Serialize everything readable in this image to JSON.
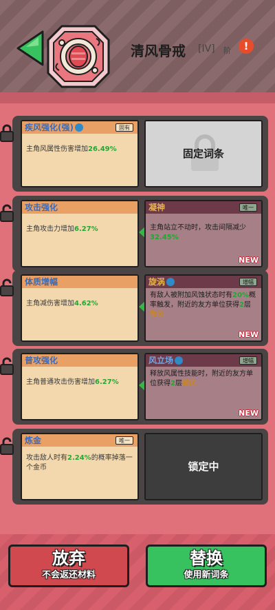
{
  "header": {
    "item_name": "清风骨戒",
    "tier": "[IV]",
    "tier_suffix": "阶",
    "warn": "!"
  },
  "rows": [
    {
      "left": {
        "title": "疾风强化(强)",
        "badge": "固有",
        "desc_pre": "主角风属性伤害增加",
        "value": "26.49%",
        "desc_post": ""
      },
      "right_state": "固定词条"
    },
    {
      "left": {
        "title": "攻击强化",
        "badge": "",
        "desc_pre": "主角攻击力增加",
        "value": "6.27%",
        "desc_post": ""
      },
      "right": {
        "title": "凝神",
        "badge": "唯一",
        "desc_pre": "主角站立不动时，攻击间隔减少",
        "value": "32.45%",
        "desc_post": "",
        "new": "NEW"
      }
    },
    {
      "left": {
        "title": "体质增幅",
        "badge": "",
        "desc_pre": "主角减伤害增加",
        "value": "4.62%",
        "desc_post": ""
      },
      "right": {
        "title": "旋涡",
        "badge": "增幅",
        "desc_pre": "有敌人被附加风蚀状态时有",
        "value": "20%",
        "desc_mid": "概率触发，附近的友方单位获得",
        "value2": "2",
        "desc_mid2": "层",
        "keyword": "微风",
        "new": "NEW"
      }
    },
    {
      "left": {
        "title": "普攻强化",
        "badge": "",
        "desc_pre": "主角普通攻击伤害增加",
        "value": "6.27%",
        "desc_post": ""
      },
      "right": {
        "title": "风立场",
        "badge": "增幅",
        "desc_pre": "释放风属性技能时，附近的友方单位获得",
        "value": "2",
        "desc_mid": "层",
        "keyword": "微风",
        "new": "NEW"
      }
    },
    {
      "left": {
        "title": "炼金",
        "badge": "唯一",
        "desc_pre": "攻击敌人时有",
        "value": "2.24%",
        "desc_post": "的概率掉落一个金币"
      },
      "right_state": "锁定中"
    }
  ],
  "buttons": {
    "abandon": {
      "label": "放弃",
      "sub": "不会返还材料"
    },
    "replace": {
      "label": "替换",
      "sub": "使用新词条"
    }
  }
}
